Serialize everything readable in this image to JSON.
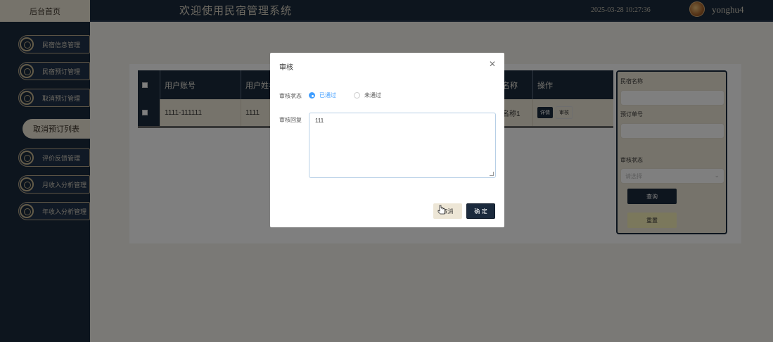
{
  "header": {
    "home_tab": "后台首页",
    "title": "欢迎使用民宿管理系统",
    "datetime": "2025-03-28 10:27:36",
    "username": "yonghu4"
  },
  "sidebar": {
    "items": [
      {
        "label": "民宿信息管理"
      },
      {
        "label": "民宿预订管理"
      },
      {
        "label": "取消预订管理"
      },
      {
        "label": "取消预订列表"
      },
      {
        "label": "评价反馈管理"
      },
      {
        "label": "月收入分析管理"
      },
      {
        "label": "年收入分析管理"
      }
    ]
  },
  "table": {
    "headers": [
      "用户账号",
      "用户姓名",
      "名称",
      "操作"
    ],
    "row": {
      "account": "1111-111111",
      "name": "1111",
      "homestay": "名称1",
      "detail_label": "详情",
      "audit_label": "审核"
    }
  },
  "search": {
    "homestay_label": "民宿名称",
    "order_label": "预订单号",
    "status_label": "审核状态",
    "status_placeholder": "请选择",
    "query_label": "查询",
    "reset_label": "重置"
  },
  "dialog": {
    "title": "审核",
    "status_label": "审核状态",
    "option_passed": "已通过",
    "option_failed": "未通过",
    "reply_label": "审核回复",
    "reply_value": "111",
    "cancel_label": "取消",
    "ok_label": "确 定"
  },
  "colors": {
    "navy": "#1b2a3d",
    "beige": "#ede6d6",
    "accent_blue": "#409eff"
  }
}
